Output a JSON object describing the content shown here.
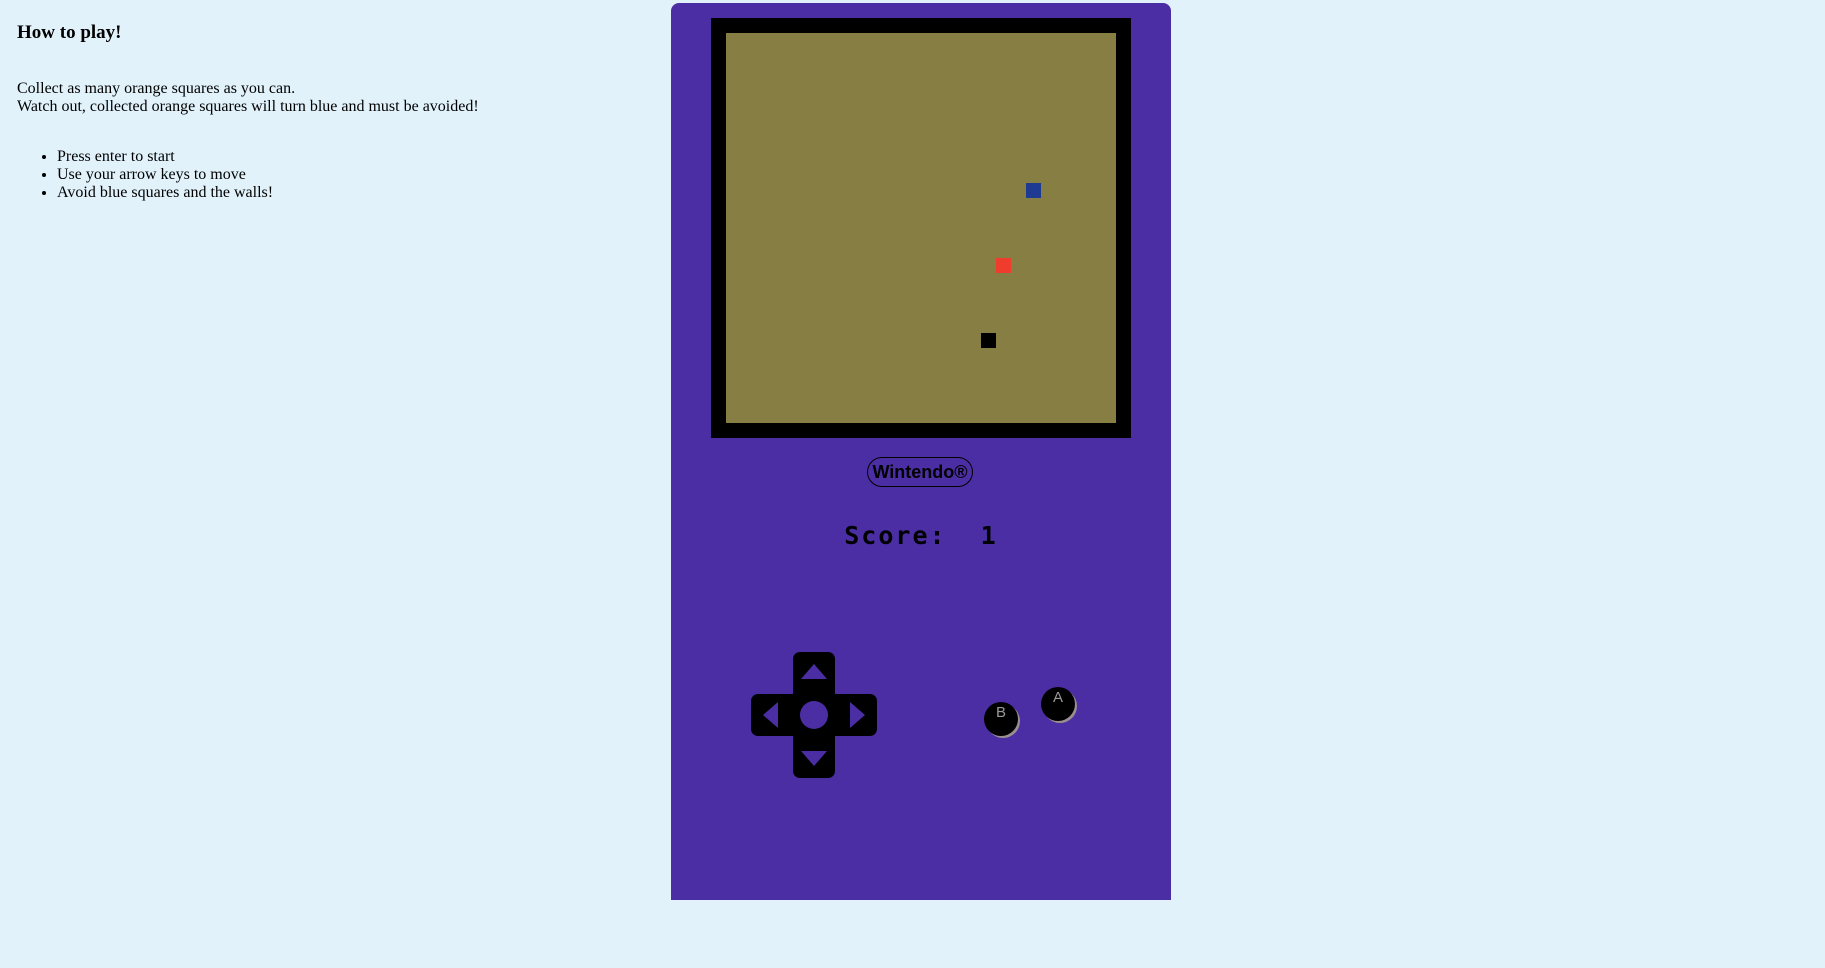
{
  "instructions": {
    "heading": "How to play!",
    "description_line1": "Collect as many orange squares as you can.",
    "description_line2": "Watch out, collected orange squares will turn blue and must be avoided!",
    "steps": [
      "Press enter to start",
      "Use your arrow keys to move",
      "Avoid blue squares and the walls!"
    ]
  },
  "console": {
    "brand": "Wintendo®",
    "score_label": "Score:",
    "score_value": "1",
    "button_b_label": "B",
    "button_a_label": "A",
    "colors": {
      "body": "#4b2ea3",
      "screen": "#877e44",
      "bezel": "#000000"
    }
  },
  "game_board": {
    "grid_size": 26,
    "pieces": [
      {
        "type": "obstacle",
        "color": "#1f3a93",
        "col": 20,
        "row": 10
      },
      {
        "type": "food",
        "color": "#f03c2c",
        "col": 18,
        "row": 15
      },
      {
        "type": "snake-head",
        "color": "#000000",
        "col": 17,
        "row": 20
      }
    ]
  }
}
